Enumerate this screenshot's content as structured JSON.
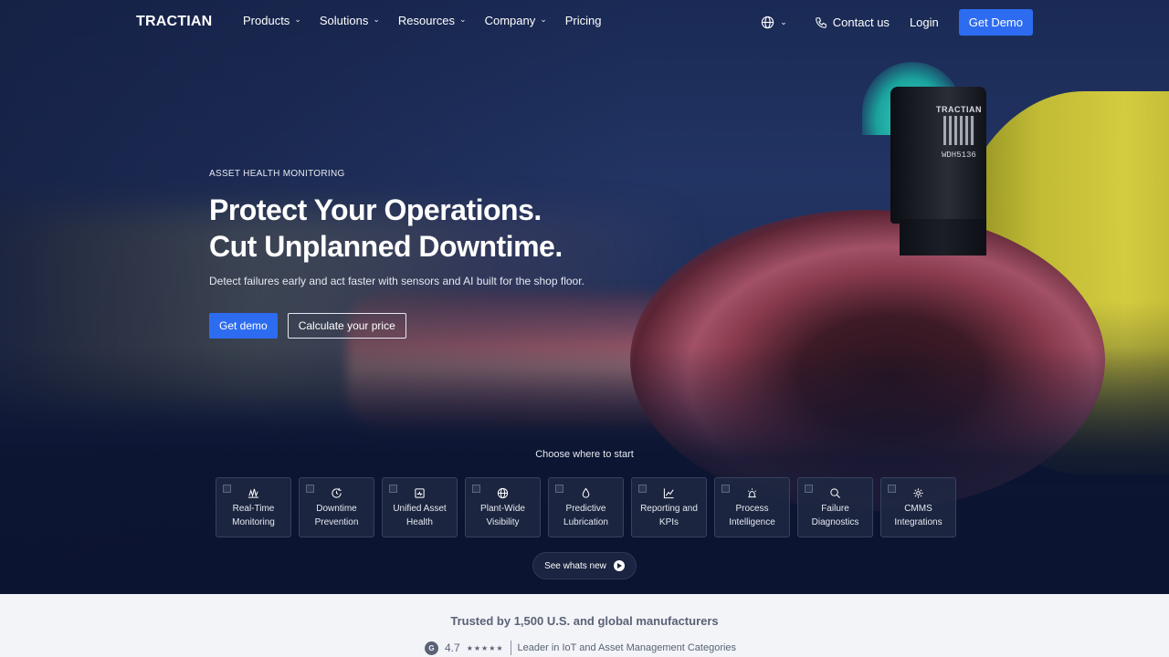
{
  "nav": {
    "logo": "TRACTIAN",
    "menu": [
      {
        "label": "Products",
        "has_dropdown": true
      },
      {
        "label": "Solutions",
        "has_dropdown": true
      },
      {
        "label": "Resources",
        "has_dropdown": true
      },
      {
        "label": "Company",
        "has_dropdown": true
      },
      {
        "label": "Pricing",
        "has_dropdown": false
      }
    ],
    "language_icon": "globe-icon",
    "contact_label": "Contact us",
    "login_label": "Login",
    "demo_label": "Get Demo",
    "accent": "#2d6cf0"
  },
  "hero": {
    "eyebrow": "ASSET HEALTH MONITORING",
    "headline_line1": "Protect Your Operations.",
    "headline_line2": "Cut Unplanned Downtime.",
    "subhead": "Detect failures early and act faster with sensors and AI built for the shop floor.",
    "primary_cta": "Get demo",
    "secondary_cta": "Calculate your price",
    "sensor_brand": "TRACTIAN",
    "sensor_code": "WDH5136"
  },
  "start": {
    "title": "Choose where to start",
    "cards": [
      {
        "line1": "Real-Time",
        "line2": "Monitoring",
        "icon": "waveform-icon"
      },
      {
        "line1": "Downtime",
        "line2": "Prevention",
        "icon": "clock-refresh-icon"
      },
      {
        "line1": "Unified Asset",
        "line2": "Health",
        "icon": "asset-health-icon"
      },
      {
        "line1": "Plant-Wide",
        "line2": "Visibility",
        "icon": "globe-icon"
      },
      {
        "line1": "Predictive",
        "line2": "Lubrication",
        "icon": "droplet-icon"
      },
      {
        "line1": "Reporting and",
        "line2": "KPIs",
        "icon": "chart-icon"
      },
      {
        "line1": "Process",
        "line2": "Intelligence",
        "icon": "alert-light-icon"
      },
      {
        "line1": "Failure",
        "line2": "Diagnostics",
        "icon": "search-icon"
      },
      {
        "line1": "CMMS",
        "line2": "Integrations",
        "icon": "gear-icon"
      }
    ],
    "whats_new": "See whats new"
  },
  "trusted": {
    "title": "Trusted by 1,500 U.S. and global manufacturers",
    "g2_mark": "G",
    "score": "4.7",
    "stars": "★★★★★",
    "category": "Leader in IoT and Asset Management Categories"
  }
}
